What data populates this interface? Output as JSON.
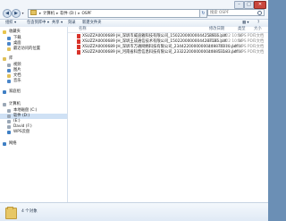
{
  "window": {
    "min": "–",
    "max": "□",
    "close": "✕"
  },
  "address": {
    "nav": {
      "back": "◀",
      "forward": "▶",
      "recent": "▾"
    },
    "segments": [
      "计算机",
      "软件 (D:)",
      "OSPF"
    ],
    "separator": "▸",
    "refresh": "↻",
    "search_placeholder": "搜索 OSPF"
  },
  "toolbar": {
    "organize": "组织 ▾",
    "include": "包含到库中 ▾",
    "share": "共享 ▾",
    "burn": "刻录",
    "new_folder": "新建文件夹",
    "view": "▦ ▾",
    "help": "?"
  },
  "nav": {
    "favorites": "收藏夹",
    "download": "下载",
    "desktop": "桌面",
    "recent": "最近访问的位置",
    "libraries": "库",
    "videos": "视频",
    "pictures": "图片",
    "documents": "文档",
    "music": "音乐",
    "homegroup": "家庭组",
    "computer": "计算机",
    "local_disk": "本地磁盘 (C:)",
    "software": "软件 (D:)",
    "disk_e": "(E:)",
    "david": "David (F:)",
    "wps": "WPS云盘",
    "network": "网络"
  },
  "columns": {
    "name": "名称",
    "date": "修改日期",
    "type": "类型",
    "size": "大小"
  },
  "files": [
    {
      "name": "XSUZZA0000689 JH_深圳市威迪雅科技有限公司_15022000000044258916.pdf",
      "date": "2023-10-22 10:56",
      "type": "WPS PDF 文档",
      "size": "1"
    },
    {
      "name": "XSUZZA0000689 JH_深圳王成通信技术有限公司_15022000000044287185.pdf",
      "date": "2023-10-22 10:56",
      "type": "WPS PDF 文档",
      "size": "1"
    },
    {
      "name": "XSUZZA0000689 JH_深圳市万通网络科技有限公司_23442200000000449876010.pdf",
      "date": "2023-10-22 10:56",
      "type": "WPS PDF 文档",
      "size": "1"
    },
    {
      "name": "XSUZZA0000689 JH_河南省科普信息科技有限公司_23322200000000440853183.pdf",
      "date": "2023-10-22 10:56",
      "type": "WPS PDF 文档",
      "size": "1"
    }
  ],
  "status": {
    "count": "4 个对象"
  },
  "colors": {
    "pdf": "#d8332b",
    "selection": "#cfe1f5",
    "close": "#c9473d"
  }
}
